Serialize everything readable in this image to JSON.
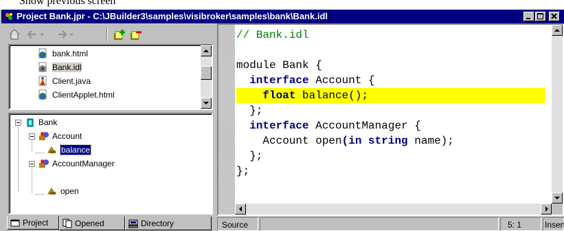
{
  "page_top_text": "Show previous screen",
  "window": {
    "title": "Project Bank.jpr - C:\\JBuilder3\\samples\\visibroker\\samples\\bank\\Bank.idl",
    "icon": "jbuilder-app-icon"
  },
  "toolbar": {
    "buttons": [
      {
        "name": "home-icon"
      },
      {
        "name": "back-icon"
      },
      {
        "name": "forward-icon"
      },
      {
        "name": "add-file-icon"
      },
      {
        "name": "remove-file-icon"
      }
    ]
  },
  "file_list": {
    "items": [
      {
        "label": "bank.html",
        "icon": "html-file-icon"
      },
      {
        "label": "Bank.idl",
        "icon": "idl-file-icon",
        "selected": true
      },
      {
        "label": "Client.java",
        "icon": "java-file-icon"
      },
      {
        "label": "ClientApplet.html",
        "icon": "html-file-icon"
      }
    ]
  },
  "structure_tree": {
    "nodes": [
      {
        "label": "Bank",
        "icon": "module-icon",
        "expanded": true
      },
      {
        "label": "Account",
        "icon": "interface-icon",
        "expanded": true
      },
      {
        "label": "balance",
        "icon": "method-icon",
        "selected": true
      },
      {
        "label": "AccountManager",
        "icon": "interface-icon",
        "expanded": true
      },
      {
        "label": "open",
        "icon": "method-icon"
      }
    ]
  },
  "editor": {
    "lines": [
      [
        {
          "t": "// Bank.idl",
          "c": "cm"
        }
      ],
      [
        {
          "t": "",
          "c": ""
        }
      ],
      [
        {
          "t": "module",
          "c": ""
        },
        {
          "t": " Bank {",
          "c": ""
        }
      ],
      [
        {
          "t": "  ",
          "c": ""
        },
        {
          "t": "interface",
          "c": "kw"
        },
        {
          "t": " Account {",
          "c": ""
        }
      ],
      [
        {
          "t": "    ",
          "c": ""
        },
        {
          "t": "float",
          "c": "kw"
        },
        {
          "t": " balance",
          "c": ""
        },
        {
          "t": "();",
          "c": ""
        }
      ],
      [
        {
          "t": "  };",
          "c": ""
        }
      ],
      [
        {
          "t": "  ",
          "c": ""
        },
        {
          "t": "interface",
          "c": "kw"
        },
        {
          "t": " AccountManager {",
          "c": ""
        }
      ],
      [
        {
          "t": "    Account open",
          "c": ""
        },
        {
          "t": "(",
          "c": "pn"
        },
        {
          "t": "in",
          "c": "kw"
        },
        {
          "t": " ",
          "c": ""
        },
        {
          "t": "string",
          "c": "kw"
        },
        {
          "t": " name);",
          "c": ""
        }
      ],
      [
        {
          "t": "  };",
          "c": ""
        }
      ],
      [
        {
          "t": "};",
          "c": ""
        }
      ]
    ],
    "highlight_line": 4,
    "highlight_color": "#ffff00"
  },
  "bottom_tabs": [
    {
      "label": "Project",
      "icon": "project-tab-icon",
      "active": true
    },
    {
      "label": "Opened",
      "icon": "opened-tab-icon"
    },
    {
      "label": "Directory",
      "icon": "directory-tab-icon"
    }
  ],
  "status": {
    "source_tab": "Source",
    "position": "5: 1",
    "mode": "Insert"
  },
  "colors": {
    "titlebar": "#000080",
    "highlight": "#ffff00",
    "comment": "#008000",
    "keyword": "#000080"
  }
}
